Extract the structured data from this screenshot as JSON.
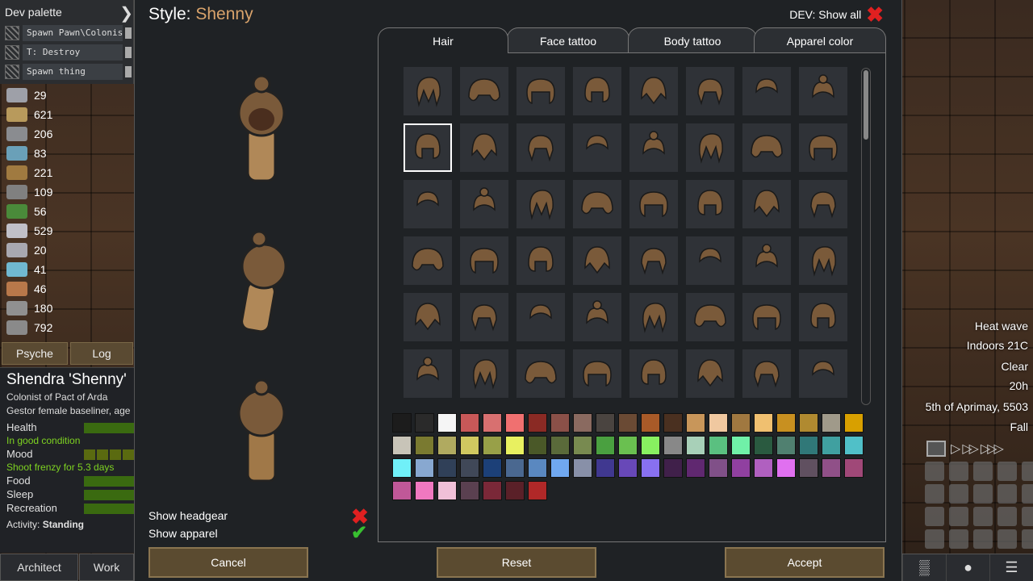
{
  "dev_palette": {
    "title": "Dev palette",
    "items": [
      {
        "label": "Spawn Pawn\\Colonist"
      },
      {
        "label": "T: Destroy"
      },
      {
        "label": "Spawn thing"
      }
    ]
  },
  "resources": [
    {
      "icon": "silver-icon",
      "color": "#9ea0a8",
      "count": "29"
    },
    {
      "icon": "wood-chunk-icon",
      "color": "#b89a5c",
      "count": "621"
    },
    {
      "icon": "stone-chunk-icon",
      "color": "#8a8c90",
      "count": "206"
    },
    {
      "icon": "plasteel-icon",
      "color": "#6aa0b8",
      "count": "83"
    },
    {
      "icon": "wood-logs-icon",
      "color": "#a07a40",
      "count": "221"
    },
    {
      "icon": "stone-blocks-icon",
      "color": "#808080",
      "count": "109"
    },
    {
      "icon": "herbal-medicine-icon",
      "color": "#4a8a3a",
      "count": "56"
    },
    {
      "icon": "cloth-icon",
      "color": "#c0c0c8",
      "count": "529"
    },
    {
      "icon": "steel-icon",
      "color": "#a8a8b0",
      "count": "20"
    },
    {
      "icon": "component-icon",
      "color": "#70b8d0",
      "count": "41"
    },
    {
      "icon": "leather-icon",
      "color": "#b8784a",
      "count": "46"
    },
    {
      "icon": "granite-blocks-icon",
      "color": "#909090",
      "count": "180"
    },
    {
      "icon": "bricks-icon",
      "color": "#8a8a8a",
      "count": "792"
    }
  ],
  "tabs_left": {
    "psyche": "Psyche",
    "log": "Log"
  },
  "pawn": {
    "name": "Shendra 'Shenny'",
    "faction": "Colonist of Pact of Arda",
    "desc": "Gestor female baseliner, age",
    "health_label": "Health",
    "health_status": "In good condition",
    "mood_label": "Mood",
    "mood_status": "Shoot frenzy for 5.3 days",
    "food_label": "Food",
    "sleep_label": "Sleep",
    "recreation_label": "Recreation",
    "activity_label": "Activity:",
    "activity_value": "Standing"
  },
  "bottom_left": {
    "architect": "Architect",
    "work": "Work"
  },
  "dialog": {
    "title_prefix": "Style:",
    "pawn_name": "Shenny",
    "dev_show_all": "DEV: Show all",
    "show_headgear": "Show headgear",
    "show_apparel": "Show apparel",
    "tabs": [
      "Hair",
      "Face tattoo",
      "Body tattoo",
      "Apparel color"
    ],
    "active_tab": "Hair",
    "hair_count": 48,
    "selected_hair_index": 8,
    "hair_color": "#7a5a3a",
    "buttons": {
      "cancel": "Cancel",
      "reset": "Reset",
      "accept": "Accept"
    }
  },
  "palette_colors": [
    "#1c1c1c",
    "#2a2a2a",
    "#f5f5f5",
    "#c85858",
    "#d87070",
    "#f07070",
    "#8a2a24",
    "#8a5048",
    "#8a6a60",
    "#4a4440",
    "#6a4a34",
    "#a85a28",
    "#4a3020",
    "#c8965a",
    "#f0c8a0",
    "#a07840",
    "#f0c070",
    "#c89020",
    "#b08a30",
    "#a09a8a",
    "#d8a000",
    "#c8c4b8",
    "#7a7a30",
    "#b0aa60",
    "#d0c860",
    "#98a048",
    "#e8f060",
    "#4a5828",
    "#5a6a3a",
    "#788a50",
    "#4aa040",
    "#6ac050",
    "#88f060",
    "#888888",
    "#a8d0b8",
    "#5ac080",
    "#70f0a8",
    "#2a5a40",
    "#508070",
    "#307878",
    "#40a0a0",
    "#50c0c8",
    "#70f0f8",
    "#88a8d0",
    "#304058",
    "#404858",
    "#1c4078",
    "#4a6890",
    "#5a88c0",
    "#70a8f0",
    "#8890a8",
    "#403890",
    "#6848b8",
    "#8870f0",
    "#40204a",
    "#602870",
    "#805088",
    "#9040a0",
    "#b060c0",
    "#e070f0",
    "#605060",
    "#905088",
    "#a04878",
    "#c05898",
    "#f078c0",
    "#f0c0d8",
    "#5a4050",
    "#7a2838",
    "#5a2028",
    "#b02828"
  ],
  "right_info": {
    "weather": "Heat wave",
    "temperature": "Indoors 21C",
    "sky": "Clear",
    "hour": "20h",
    "date": "5th of Aprimay, 5503",
    "season": "Fall"
  }
}
